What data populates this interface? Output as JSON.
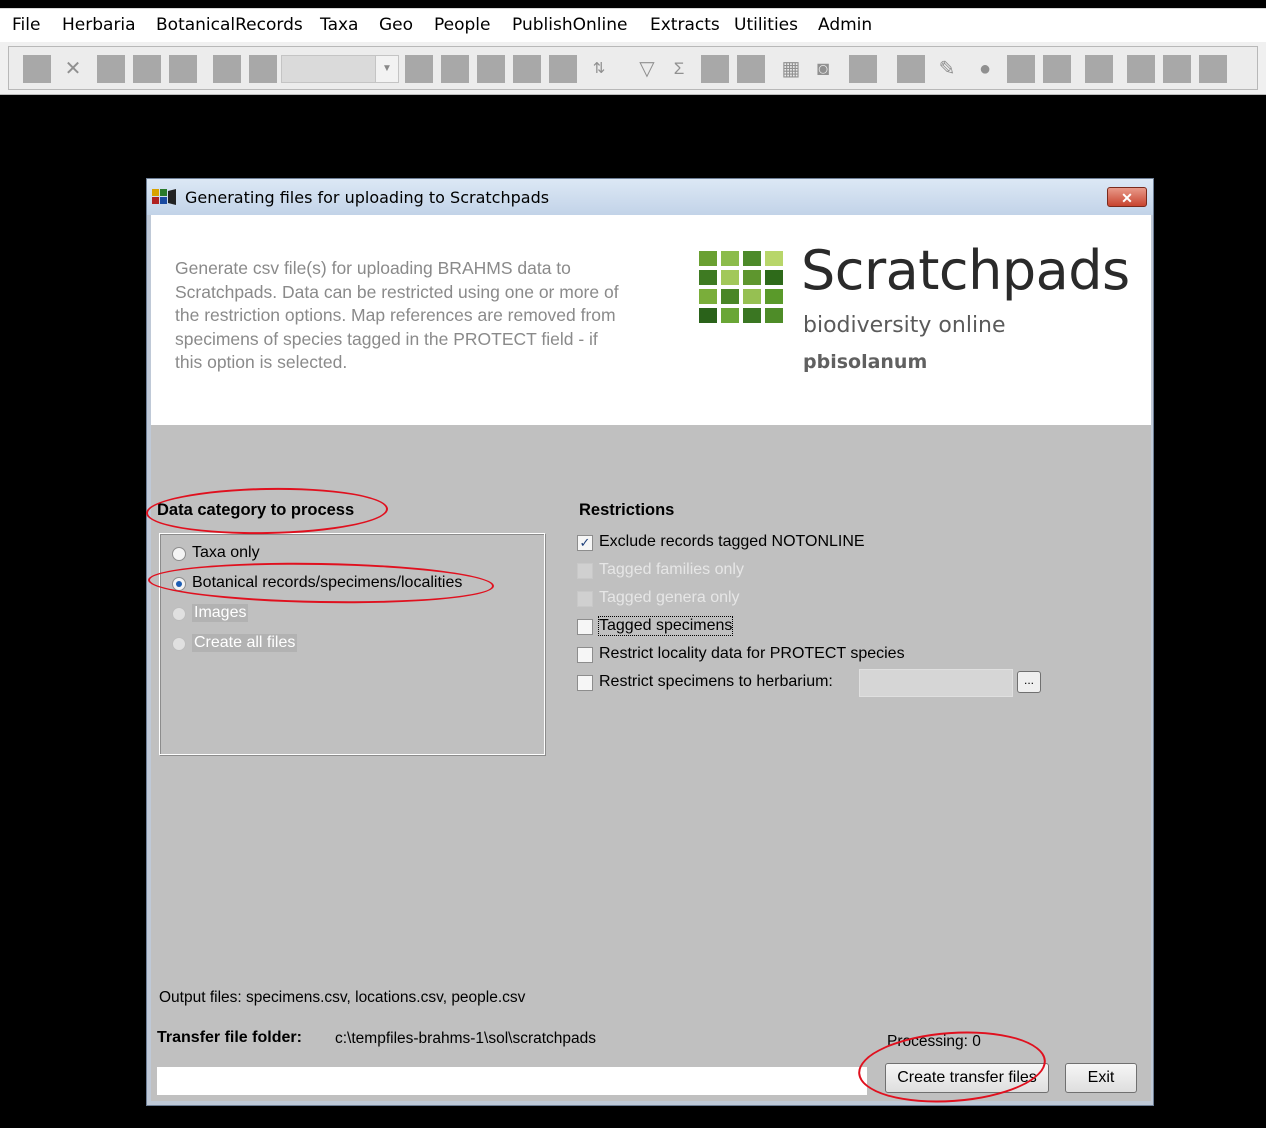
{
  "menubar": {
    "items": [
      "File",
      "Herbaria",
      "BotanicalRecords",
      "Taxa",
      "Geo",
      "People",
      "PublishOnline",
      "Extracts",
      "Utilities",
      "Admin"
    ]
  },
  "dialog": {
    "title": "Generating files for uploading to Scratchpads",
    "close_label": "✕",
    "description": "Generate csv file(s) for uploading BRAHMS data to Scratchpads. Data can be restricted using one or more of the restriction options. Map references are removed  from specimens of species tagged in the PROTECT field - if this option is selected.",
    "logo": {
      "wordmark": "Scratchpads",
      "tagline": "biodiversity online",
      "site": "pbisolanum"
    },
    "category": {
      "title": "Data category to process",
      "options": [
        {
          "label": "Taxa only",
          "selected": false,
          "enabled": true
        },
        {
          "label": "Botanical records/specimens/localities",
          "selected": true,
          "enabled": true
        },
        {
          "label": "Images",
          "selected": false,
          "enabled": false
        },
        {
          "label": "Create all files",
          "selected": false,
          "enabled": false
        }
      ]
    },
    "restrictions": {
      "title": "Restrictions",
      "options": [
        {
          "label": "Exclude records tagged NOTONLINE",
          "checked": true,
          "enabled": true
        },
        {
          "label": "Tagged families only",
          "checked": false,
          "enabled": false
        },
        {
          "label": "Tagged genera only",
          "checked": false,
          "enabled": false
        },
        {
          "label": "Tagged specimens",
          "checked": false,
          "enabled": true
        },
        {
          "label": "Restrict locality data for PROTECT species",
          "checked": false,
          "enabled": true
        },
        {
          "label": "Restrict specimens to herbarium:",
          "checked": false,
          "enabled": true
        }
      ],
      "herbarium_value": "",
      "browse_label": "..."
    },
    "output_files": "Output files: specimens.csv, locations.csv, people.csv",
    "transfer_folder_label": "Transfer file folder:",
    "transfer_folder_value": "c:\\tempfiles-brahms-1\\sol\\scratchpads",
    "processing": "Processing:  0",
    "path_value": "",
    "create_button": "Create transfer files",
    "exit_button": "Exit"
  },
  "colors": {
    "annotation": "#e0101e",
    "dialog_bg": "#c0c0c0",
    "logo_green": "#5a9a2a"
  }
}
